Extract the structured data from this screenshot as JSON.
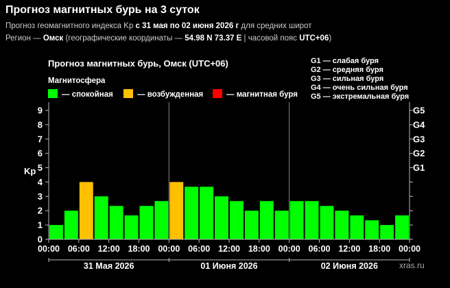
{
  "header": {
    "title": "Прогноз магнитных бурь на 3 суток",
    "line1_prefix": "Прогноз геомагнитного индекса Kp ",
    "line1_period": "с 31 мая по 02 июня 2026 г",
    "line1_suffix": " для средних широт",
    "line2_prefix": "Регион — ",
    "line2_region": "Омск",
    "line2_mid": " (географические координаты — ",
    "line2_coords": "54.98 N 73.37 E",
    "line2_sep": " | часовой пояс ",
    "line2_tz": "UTC+06",
    "line2_end": ")"
  },
  "chart_data": {
    "type": "bar",
    "title": "Прогноз магнитных бурь, Омск (UTC+06)",
    "ylabel": "Kp",
    "ylim": [
      0,
      9
    ],
    "yticks": [
      "0",
      "1",
      "2",
      "3",
      "4",
      "5",
      "6",
      "7",
      "8",
      "9"
    ],
    "right_ticks": [
      {
        "label": "G1",
        "kp": 5
      },
      {
        "label": "G2",
        "kp": 6
      },
      {
        "label": "G3",
        "kp": 7
      },
      {
        "label": "G4",
        "kp": 8
      },
      {
        "label": "G5",
        "kp": 9
      }
    ],
    "legend_title": "Магнитосфера",
    "legend": [
      {
        "label": "— спокойная",
        "color": "#00ff00"
      },
      {
        "label": "— возбужденная",
        "color": "#ffc000"
      },
      {
        "label": "— магнитная буря",
        "color": "#ff0000"
      }
    ],
    "g_legend": [
      "G1 — слабая буря",
      "G2 — средняя буря",
      "G3 — сильная буря",
      "G4 — очень сильная буря",
      "G5 — экстремальная буря"
    ],
    "days": [
      "31 Мая 2026",
      "01 Июня 2026",
      "02 Июня 2026"
    ],
    "xtick_labels": [
      "00:00",
      "06:00",
      "12:00",
      "18:00",
      "00:00",
      "06:00",
      "12:00",
      "18:00",
      "00:00",
      "06:00",
      "12:00",
      "18:00",
      "00:00"
    ],
    "values": [
      1,
      2,
      4,
      3,
      2.33,
      1.67,
      2.33,
      2.67,
      4,
      3.67,
      3.67,
      3,
      2.67,
      2,
      2.67,
      2,
      2.67,
      2.67,
      2.33,
      2,
      1.67,
      1.33,
      1,
      1.67
    ],
    "watermark": "xras.ru"
  }
}
